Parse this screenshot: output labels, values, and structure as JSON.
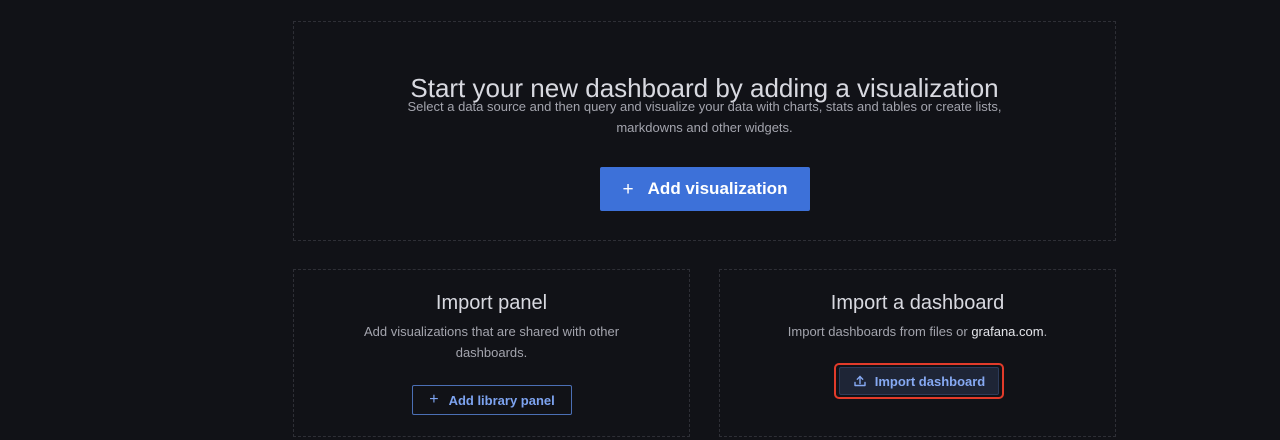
{
  "main": {
    "title": "Start your new dashboard by adding a visualization",
    "description": "Select a data source and then query and visualize your data with charts, stats and tables or create lists, markdowns and other widgets.",
    "button_label": "Add visualization",
    "button_icon": "plus-icon"
  },
  "import_panel": {
    "title": "Import panel",
    "description": "Add visualizations that are shared with other dashboards.",
    "button_label": "Add library panel",
    "button_icon": "plus-icon"
  },
  "import_dashboard": {
    "title": "Import a dashboard",
    "description_prefix": "Import dashboards from files or ",
    "description_link": "grafana.com",
    "description_suffix": ".",
    "button_label": "Import dashboard",
    "button_icon": "upload-icon"
  },
  "colors": {
    "background": "#111217",
    "primary": "#3d71d9",
    "highlight_outline": "#e23b2a"
  }
}
